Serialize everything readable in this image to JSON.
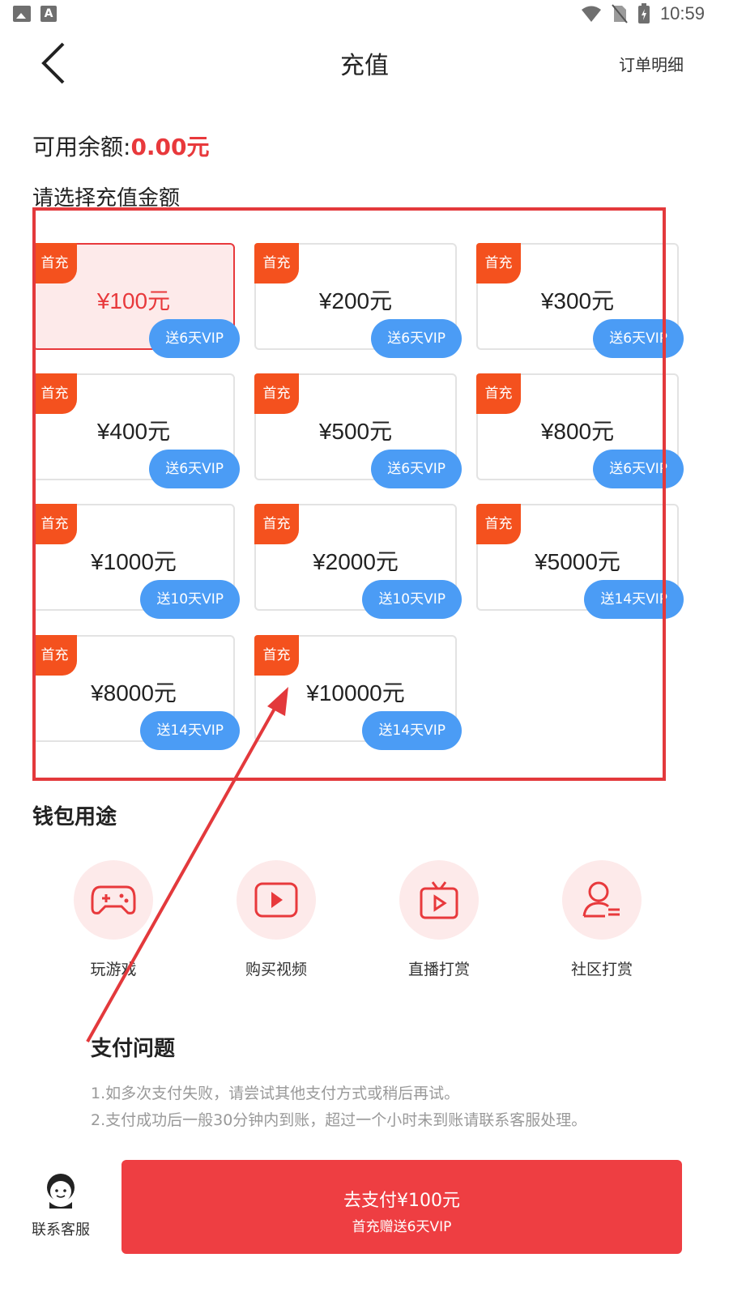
{
  "status_bar": {
    "time": "10:59"
  },
  "header": {
    "title": "充值",
    "order_link": "订单明细"
  },
  "balance": {
    "label": "可用余额:",
    "value": "0.00元"
  },
  "select_label": "请选择充值金额",
  "cards": [
    {
      "badge": "首充",
      "amount": "¥100元",
      "bonus": "送6天VIP",
      "selected": true
    },
    {
      "badge": "首充",
      "amount": "¥200元",
      "bonus": "送6天VIP"
    },
    {
      "badge": "首充",
      "amount": "¥300元",
      "bonus": "送6天VIP"
    },
    {
      "badge": "首充",
      "amount": "¥400元",
      "bonus": "送6天VIP"
    },
    {
      "badge": "首充",
      "amount": "¥500元",
      "bonus": "送6天VIP"
    },
    {
      "badge": "首充",
      "amount": "¥800元",
      "bonus": "送6天VIP"
    },
    {
      "badge": "首充",
      "amount": "¥1000元",
      "bonus": "送10天VIP"
    },
    {
      "badge": "首充",
      "amount": "¥2000元",
      "bonus": "送10天VIP"
    },
    {
      "badge": "首充",
      "amount": "¥5000元",
      "bonus": "送14天VIP"
    },
    {
      "badge": "首充",
      "amount": "¥8000元",
      "bonus": "送14天VIP"
    },
    {
      "badge": "首充",
      "amount": "¥10000元",
      "bonus": "送14天VIP"
    }
  ],
  "wallet_uses": {
    "title": "钱包用途",
    "items": [
      {
        "label": "玩游戏",
        "icon": "gamepad-icon"
      },
      {
        "label": "购买视频",
        "icon": "play-video-icon"
      },
      {
        "label": "直播打赏",
        "icon": "tv-live-icon"
      },
      {
        "label": "社区打赏",
        "icon": "user-community-icon"
      }
    ]
  },
  "faq": {
    "title": "支付问题",
    "lines": [
      "1.如多次支付失败，请尝试其他支付方式或稍后再试。",
      "2.支付成功后一般30分钟内到账，超过一个小时未到账请联系客服处理。"
    ]
  },
  "footer": {
    "service_label": "联系客服",
    "pay_label": "去支付¥100元",
    "pay_sub": "首充赠送6天VIP"
  },
  "colors": {
    "accent": "#e8393c",
    "badge": "#f4511e",
    "bonus": "#4b9cf5",
    "pay": "#ee3e42"
  }
}
